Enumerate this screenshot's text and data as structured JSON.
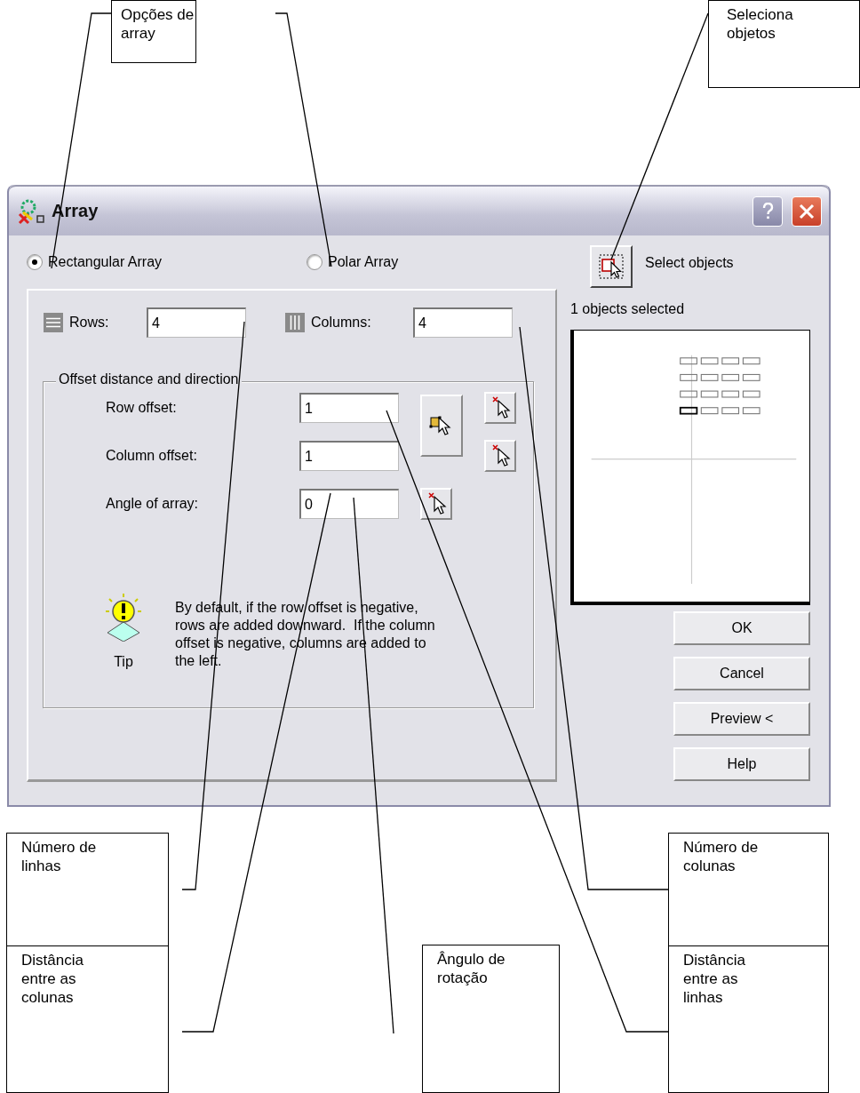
{
  "callouts": [
    {
      "text": "Opções de array"
    },
    {
      "text": "Seleciona objetos"
    },
    {
      "text": "Número de linhas"
    },
    {
      "text": "Número de colunas"
    },
    {
      "text": "Distância entre as colunas"
    },
    {
      "text": "Ângulo de rotação"
    },
    {
      "text": "Distância entre as linhas"
    }
  ],
  "dialog": {
    "title": "Array",
    "array_types": [
      {
        "label": "Rectangular Array",
        "selected": true
      },
      {
        "label": "Polar Array",
        "selected": false
      }
    ],
    "select_objects": {
      "label": "Select objects"
    },
    "selection_status": "1 objects selected",
    "counts": [
      {
        "kind": "rows",
        "label": "Rows:",
        "value": "4"
      },
      {
        "kind": "columns",
        "label": "Columns:",
        "value": "4"
      }
    ],
    "offset_group": {
      "title": "Offset distance and direction",
      "fields": [
        {
          "label": "Row offset:",
          "value": "1"
        },
        {
          "label": "Column offset:",
          "value": "1"
        },
        {
          "label": "Angle of array:",
          "value": "0"
        }
      ]
    },
    "tip": {
      "label": "Tip",
      "text": "By default, if the row offset is negative, rows are added downward.  If the column offset is negative, columns are added to the left."
    },
    "buttons": [
      "OK",
      "Cancel",
      "Preview <",
      "Help"
    ]
  }
}
